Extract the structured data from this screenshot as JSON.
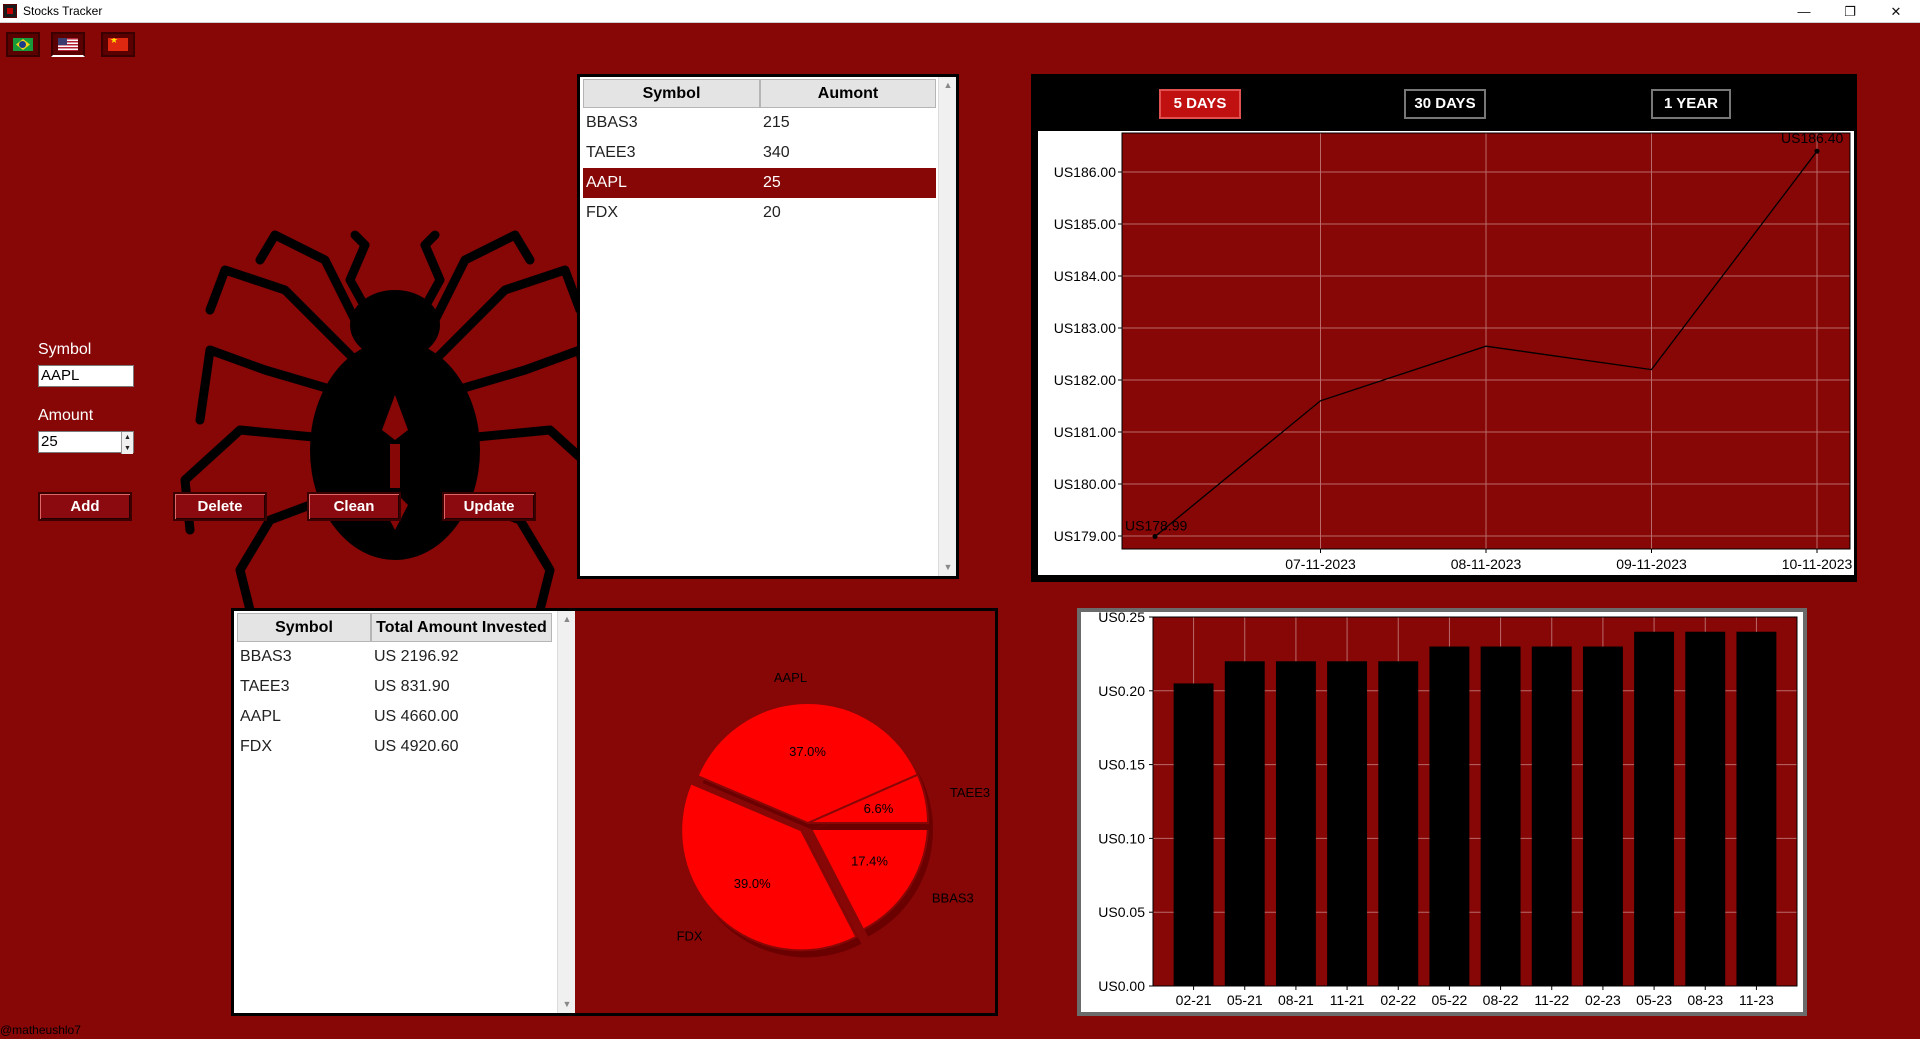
{
  "window": {
    "title": "Stocks Tracker",
    "controls": [
      "—",
      "❐",
      "✕"
    ]
  },
  "languages": {
    "options": [
      "Portuguese (Brazil)",
      "English (US)",
      "Chinese"
    ],
    "selected": "English (US)"
  },
  "form": {
    "symbol_label": "Symbol",
    "symbol_value": "AAPL",
    "amount_label": "Amount",
    "amount_value": "25",
    "buttons": {
      "add": "Add",
      "delete": "Delete",
      "clean": "Clean",
      "update": "Update"
    }
  },
  "holdings_table": {
    "columns": [
      "Symbol",
      "Aumont"
    ],
    "rows": [
      {
        "symbol": "BBAS3",
        "amount": "215"
      },
      {
        "symbol": "TAEE3",
        "amount": "340"
      },
      {
        "symbol": "AAPL",
        "amount": "25"
      },
      {
        "symbol": "FDX",
        "amount": "20"
      }
    ],
    "selected_index": 2
  },
  "invested_table": {
    "columns": [
      "Symbol",
      "Total Amount Invested"
    ],
    "rows": [
      {
        "symbol": "BBAS3",
        "total": "US 2196.92"
      },
      {
        "symbol": "TAEE3",
        "total": "US 831.90"
      },
      {
        "symbol": "AAPL",
        "total": "US 4660.00"
      },
      {
        "symbol": "FDX",
        "total": "US 4920.60"
      }
    ]
  },
  "range_buttons": {
    "five_days": "5 DAYS",
    "thirty_days": "30 DAYS",
    "one_year": "1 YEAR",
    "selected": "5 DAYS"
  },
  "footer": {
    "credit": "@matheushlo7"
  },
  "colors": {
    "background": "#870606",
    "plot_bg": "#870606",
    "pie_fill": "#ff0000",
    "bar_fill": "#000000",
    "selection": "#870606"
  },
  "chart_data": [
    {
      "type": "line",
      "x": [
        "06-11-2023",
        "07-11-2023",
        "08-11-2023",
        "09-11-2023",
        "10-11-2023"
      ],
      "values": [
        178.99,
        181.6,
        182.65,
        182.2,
        186.4
      ],
      "x_tick_labels": [
        "07-11-2023",
        "08-11-2023",
        "09-11-2023",
        "10-11-2023"
      ],
      "y_ticks": [
        179,
        180,
        181,
        182,
        183,
        184,
        185,
        186
      ],
      "y_tick_prefix": "US",
      "ylim": [
        178.75,
        186.75
      ],
      "annotations": {
        "first": "US178.99",
        "last": "US186.40"
      },
      "grid": true
    },
    {
      "type": "pie",
      "slices": [
        {
          "label": "BBAS3",
          "value": 17.4,
          "pct_label": "17.4%"
        },
        {
          "label": "FDX",
          "value": 39.0,
          "pct_label": "39.0%"
        },
        {
          "label": "AAPL",
          "value": 37.0,
          "pct_label": "37.0%"
        },
        {
          "label": "TAEE3",
          "value": 6.6,
          "pct_label": "6.6%"
        }
      ],
      "exploded": "FDX"
    },
    {
      "type": "bar",
      "categories": [
        "02-21",
        "05-21",
        "08-21",
        "11-21",
        "02-22",
        "05-22",
        "08-22",
        "11-22",
        "02-23",
        "05-23",
        "08-23",
        "11-23"
      ],
      "values": [
        0.205,
        0.22,
        0.22,
        0.22,
        0.22,
        0.23,
        0.23,
        0.23,
        0.23,
        0.24,
        0.24,
        0.24
      ],
      "y_tick_labels": [
        "US0.00",
        "US0.05",
        "US0.10",
        "US0.15",
        "US0.20",
        "US0.25"
      ],
      "ylim": [
        0,
        0.25
      ],
      "grid": true
    }
  ]
}
